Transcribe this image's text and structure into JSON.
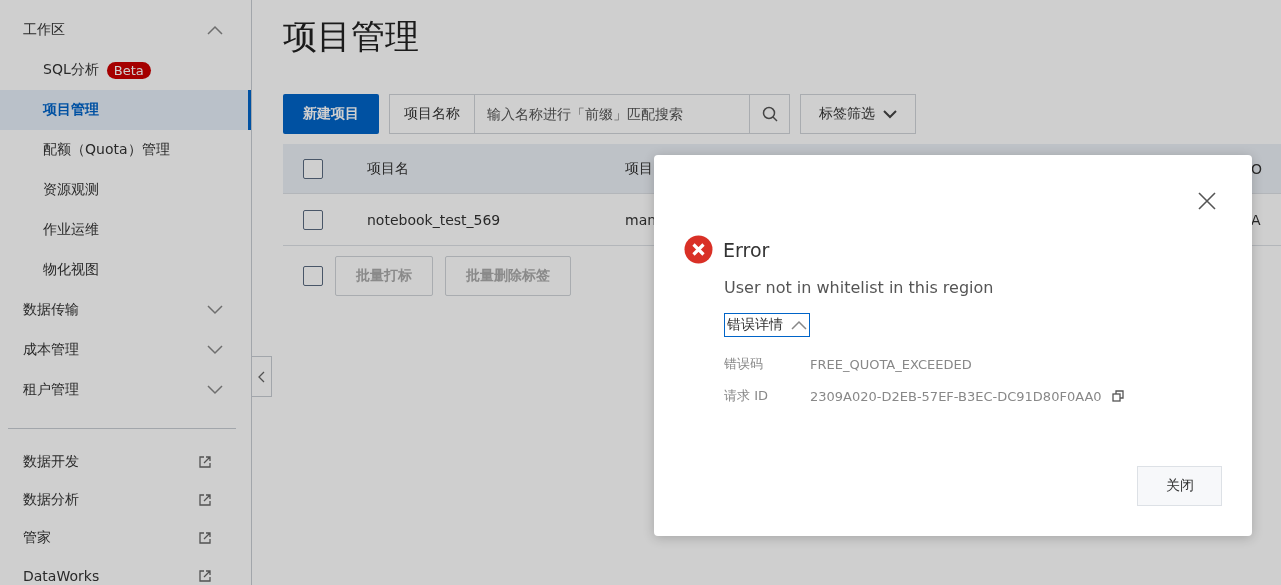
{
  "sidebar": {
    "groups": [
      {
        "label": "工作区",
        "expanded": true,
        "children": [
          {
            "label": "SQL分析",
            "badge": "Beta",
            "selected": false
          },
          {
            "label": "项目管理",
            "selected": true
          },
          {
            "label": "配额（Quota）管理",
            "selected": false
          },
          {
            "label": "资源观测",
            "selected": false
          },
          {
            "label": "作业运维",
            "selected": false
          },
          {
            "label": "物化视图",
            "selected": false
          }
        ]
      },
      {
        "label": "数据传输",
        "expanded": false
      },
      {
        "label": "成本管理",
        "expanded": false
      },
      {
        "label": "租户管理",
        "expanded": false
      }
    ],
    "links": [
      {
        "label": "数据开发"
      },
      {
        "label": "数据分析"
      },
      {
        "label": "管家"
      },
      {
        "label": "DataWorks"
      }
    ]
  },
  "page": {
    "title": "项目管理"
  },
  "toolbar": {
    "create_button": "新建项目",
    "search_label": "项目名称",
    "search_placeholder": "输入名称进行「前缀」匹配搜索",
    "tag_filter": "标签筛选"
  },
  "table": {
    "columns": [
      {
        "label": "项目名"
      },
      {
        "label": "项目"
      },
      {
        "label": "O"
      }
    ],
    "rows": [
      {
        "checked": false,
        "cells": [
          "notebook_test_569",
          "man",
          "A"
        ]
      }
    ],
    "footer": {
      "checked": false,
      "buttons": [
        {
          "label": "批量打标",
          "disabled": true
        },
        {
          "label": "批量删除标签",
          "disabled": true
        }
      ]
    }
  },
  "header_checked": false,
  "dialog": {
    "title": "Error",
    "message": "User not in whitelist in this region",
    "details_toggle": "错误详情",
    "details_expanded": true,
    "details": [
      {
        "label": "错误码",
        "value": "FREE_QUOTA_EXCEEDED",
        "copyable": false
      },
      {
        "label": "请求 ID",
        "value": "2309A020-D2EB-57EF-B3EC-DC91D80F0AA0",
        "copyable": true
      }
    ],
    "close_button": "关闭"
  }
}
